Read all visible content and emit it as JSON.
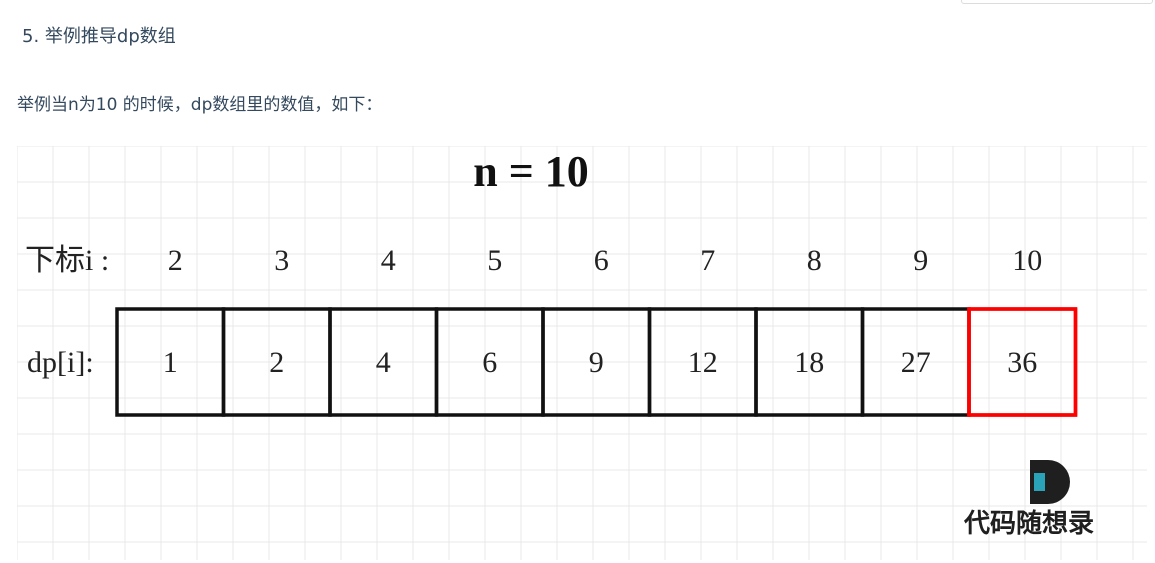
{
  "heading": "5. 举例推导dp数组",
  "intro": "举例当n为10 的时候，dp数组里的数值，如下：",
  "figure": {
    "title": "n = 10",
    "index_label": "下标i :",
    "dp_label": "dp[i]:",
    "indices": [
      "2",
      "3",
      "4",
      "5",
      "6",
      "7",
      "8",
      "9",
      "10"
    ],
    "values": [
      "1",
      "2",
      "4",
      "6",
      "9",
      "12",
      "18",
      "27",
      "36"
    ],
    "highlight_index": 8,
    "highlight_color": "#ff0000",
    "grid_color": "#e9e9e9",
    "logo_text": "代码随想录",
    "logo_color": "#1f1f1f",
    "logo_accent_color": "#2aa3b8"
  }
}
